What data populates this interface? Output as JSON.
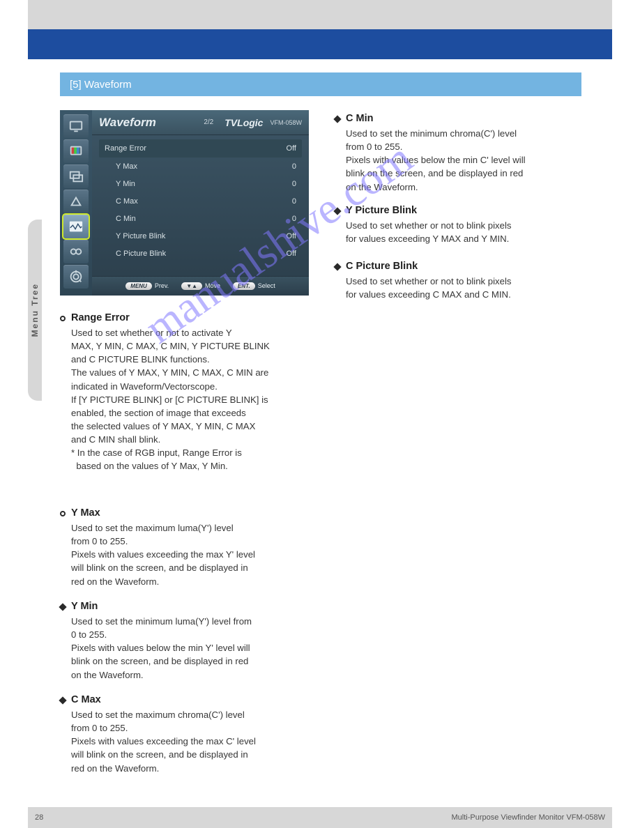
{
  "doc": {
    "section_title": "[5] Waveform",
    "page_num": "28",
    "model_footer": "Multi-Purpose Viewfinder Monitor  VFM-058W",
    "sidebar": "Menu Tree"
  },
  "osd": {
    "title": "Waveform",
    "page": "2/2",
    "brand": "TVLogic",
    "model": "VFM-058W",
    "rows": [
      {
        "label": "Range Error",
        "value": "Off",
        "type": "hdr"
      },
      {
        "label": "Y Max",
        "value": "0",
        "type": "sub"
      },
      {
        "label": "Y Min",
        "value": "0",
        "type": "sub"
      },
      {
        "label": "C Max",
        "value": "0",
        "type": "sub"
      },
      {
        "label": "C Min",
        "value": "0",
        "type": "sub"
      },
      {
        "label": "Y Picture Blink",
        "value": "Off",
        "type": "sub"
      },
      {
        "label": "C Picture Blink",
        "value": "Off",
        "type": "sub"
      }
    ],
    "footer": {
      "prev": "Prev.",
      "move": "Move",
      "select": "Select",
      "prev_btn": "MENU",
      "move_btn": "▼▲",
      "select_btn": "ENT."
    }
  },
  "left": {
    "range_error": {
      "heading": "Range Error",
      "body": "Used to set whether or not to activate Y\nMAX, Y MIN, C MAX, C MIN, Y PICTURE BLINK\nand C PICTURE BLINK functions.\nThe values of Y MAX, Y MIN, C MAX, C MIN are\nindicated in Waveform/Vectorscope.\nIf [Y PICTURE BLINK] or [C PICTURE BLINK] is\nenabled, the section of image that exceeds\nthe selected values of Y MAX, Y MIN, C MAX\nand C MIN shall blink.\n* In the case of RGB input, Range Error is\n  based on the values of Y Max, Y Min."
    },
    "y_max": {
      "heading": "Y Max",
      "body": "Used to set the maximum luma(Y') level\nfrom 0 to 255.\nPixels with values exceeding the max Y' level\nwill blink on the screen, and be displayed in\nred on the Waveform."
    },
    "y_min": {
      "heading": "Y Min",
      "body": "Used to set the minimum luma(Y') level from\n0 to 255.\nPixels with values below the min Y' level will\nblink on the screen, and be displayed in red\non the Waveform."
    },
    "c_max": {
      "heading": "C Max",
      "body": "Used to set the maximum chroma(C') level\nfrom 0 to 255.\nPixels with values exceeding the max C' level\nwill blink on the screen, and be displayed in\nred on the Waveform."
    }
  },
  "right": {
    "c_min": {
      "heading": "C Min",
      "body": "Used to set the minimum chroma(C') level\nfrom 0 to 255.\nPixels with values below the min C' level will\nblink on the screen, and be displayed in red\non the Waveform."
    },
    "y_blink": {
      "heading": "Y Picture Blink",
      "body": "Used to set whether or not to blink pixels\nfor values exceeding Y MAX and Y MIN."
    },
    "c_blink": {
      "heading": "C Picture Blink",
      "body": "Used to set whether or not to blink pixels\nfor values exceeding C MAX and C MIN."
    }
  },
  "watermark": "manualshive.com"
}
